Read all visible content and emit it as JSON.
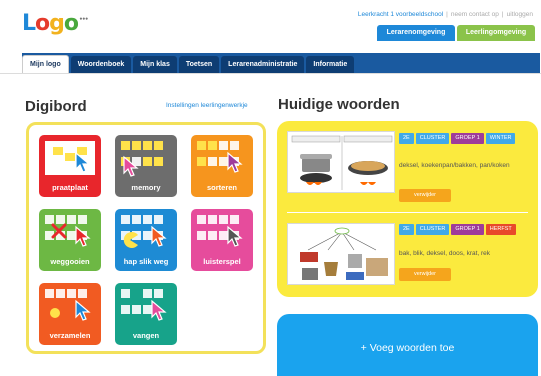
{
  "header": {
    "logo_parts": [
      "L",
      "o",
      "g",
      "o"
    ],
    "logo_suffix": "•••",
    "school_link": "Leerkracht 1 voorbeeldschool",
    "contact_link": "neem contact op",
    "logout_link": "uitloggen",
    "env_tabs": [
      {
        "label": "Lerarenomgeving",
        "color": "#1e88d8"
      },
      {
        "label": "Leerlingomgeving",
        "color": "#8bc34a"
      }
    ]
  },
  "nav": {
    "tabs": [
      "Mijn logo",
      "Woordenboek",
      "Mijn klas",
      "Toetsen",
      "Lerarenadministratie",
      "Informatie"
    ],
    "active": "Mijn logo"
  },
  "digibord": {
    "title": "Digibord",
    "settings_link": "Instellingen leerlingenwerkje",
    "games": [
      {
        "label": "praatplaat",
        "color": "#e8262c",
        "icon": "pointer-icon"
      },
      {
        "label": "memory",
        "color": "#6d6d6d",
        "icon": "pointer-icon"
      },
      {
        "label": "sorteren",
        "color": "#f6951e",
        "icon": "pointer-icon"
      },
      {
        "label": "weggooien",
        "color": "#6db844",
        "icon": "cross-icon"
      },
      {
        "label": "hap slik weg",
        "color": "#1e8bd4",
        "icon": "pacman-icon"
      },
      {
        "label": "luisterspel",
        "color": "#e64c9c",
        "icon": "pointer-icon"
      },
      {
        "label": "verzamelen",
        "color": "#f15b22",
        "icon": "coin-icon"
      },
      {
        "label": "vangen",
        "color": "#17a38a",
        "icon": "pointer-icon"
      }
    ]
  },
  "words": {
    "title": "Huidige woorden",
    "groups": [
      {
        "tags": [
          {
            "text": "2E",
            "color": "blue"
          },
          {
            "text": "CLUSTER",
            "color": "blue"
          },
          {
            "text": "GROEP 1",
            "color": "purple"
          },
          {
            "text": "WINTER",
            "color": "blue"
          }
        ],
        "words": "deksel, koekenpan/bakken, pan/koken",
        "delete_label": "verwijder"
      },
      {
        "tags": [
          {
            "text": "2E",
            "color": "blue"
          },
          {
            "text": "CLUSTER",
            "color": "blue"
          },
          {
            "text": "GROEP 1",
            "color": "purple"
          },
          {
            "text": "HERFST",
            "color": "red"
          }
        ],
        "words": "bak, blik, deksel, doos, krat, rek",
        "delete_label": "verwijder"
      }
    ],
    "add_label": "+ Voeg woorden toe"
  }
}
